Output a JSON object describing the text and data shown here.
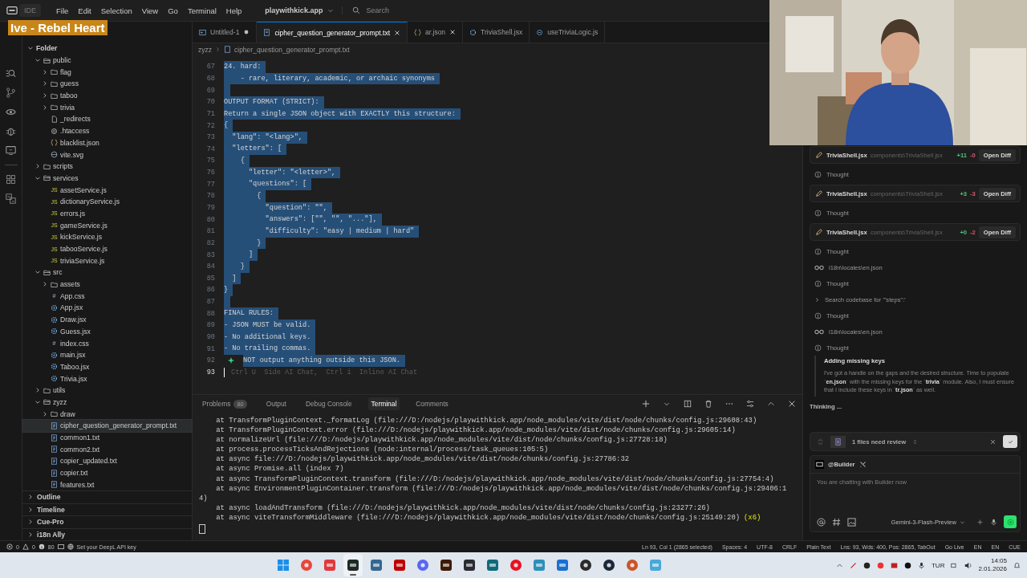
{
  "overlay": {
    "title": "Ive - Rebel Heart"
  },
  "titlebar": {
    "app": "IDE",
    "menus": [
      "File",
      "Edit",
      "Selection",
      "View",
      "Go",
      "Terminal",
      "Help"
    ],
    "workspace": "playwithkick.app",
    "search": {
      "placeholder": "Search"
    }
  },
  "tabs": [
    {
      "label": "Untitled-1",
      "kind": "preview",
      "selected": false,
      "modified": true
    },
    {
      "label": "cipher_question_generator_prompt.txt",
      "kind": "txt",
      "selected": true,
      "modified": false
    },
    {
      "label": "ar.json",
      "kind": "json",
      "selected": false,
      "modified": false
    },
    {
      "label": "TriviaShell.jsx",
      "kind": "react",
      "selected": false,
      "modified": false
    },
    {
      "label": "useTriviaLogic.js",
      "kind": "js",
      "selected": false,
      "modified": false
    }
  ],
  "breadcrumb": [
    "zyzz",
    "cipher_question_generator_prompt.txt"
  ],
  "explorer": {
    "tree": [
      {
        "label": "Folder",
        "kind": "root",
        "expanded": true,
        "selected": false,
        "children": [
          {
            "label": "public",
            "kind": "folder",
            "expanded": true,
            "selected": false,
            "children": [
              {
                "label": "flag",
                "kind": "folder",
                "expanded": false,
                "selected": false
              },
              {
                "label": "guess",
                "kind": "folder",
                "expanded": false,
                "selected": false
              },
              {
                "label": "taboo",
                "kind": "folder",
                "expanded": false,
                "selected": false
              },
              {
                "label": "trivia",
                "kind": "folder",
                "expanded": false,
                "selected": false
              },
              {
                "label": "_redirects",
                "kind": "file",
                "selected": false
              },
              {
                "label": ".htaccess",
                "kind": "gear",
                "selected": false
              },
              {
                "label": "blacklist.json",
                "kind": "json",
                "selected": false
              },
              {
                "label": "vite.svg",
                "kind": "svg",
                "selected": false
              }
            ]
          },
          {
            "label": "scripts",
            "kind": "folder",
            "expanded": false,
            "selected": false
          },
          {
            "label": "services",
            "kind": "folder",
            "expanded": true,
            "selected": false,
            "children": [
              {
                "label": "assetService.js",
                "kind": "js",
                "icon_text": "JS",
                "selected": false
              },
              {
                "label": "dictionaryService.js",
                "kind": "js",
                "icon_text": "JS",
                "selected": false
              },
              {
                "label": "errors.js",
                "kind": "js",
                "icon_text": "JS",
                "selected": false
              },
              {
                "label": "gameService.js",
                "kind": "js",
                "icon_text": "JS",
                "selected": false
              },
              {
                "label": "kickService.js",
                "kind": "js",
                "icon_text": "JS",
                "selected": false
              },
              {
                "label": "tabooService.js",
                "kind": "js",
                "icon_text": "JS",
                "selected": false
              },
              {
                "label": "triviaService.js",
                "kind": "js",
                "icon_text": "JS",
                "selected": false
              }
            ]
          },
          {
            "label": "src",
            "kind": "folder",
            "expanded": true,
            "selected": false,
            "children": [
              {
                "label": "assets",
                "kind": "folder",
                "expanded": false,
                "selected": false
              },
              {
                "label": "App.css",
                "kind": "css",
                "icon_text": "#",
                "selected": false
              },
              {
                "label": "App.jsx",
                "kind": "react",
                "selected": false
              },
              {
                "label": "Draw.jsx",
                "kind": "react",
                "selected": false
              },
              {
                "label": "Guess.jsx",
                "kind": "react",
                "selected": false
              },
              {
                "label": "index.css",
                "kind": "css",
                "icon_text": "#",
                "selected": false
              },
              {
                "label": "main.jsx",
                "kind": "react",
                "selected": false
              },
              {
                "label": "Taboo.jsx",
                "kind": "react",
                "selected": false
              },
              {
                "label": "Trivia.jsx",
                "kind": "react",
                "selected": false
              }
            ]
          },
          {
            "label": "utils",
            "kind": "folder",
            "expanded": false,
            "selected": false
          },
          {
            "label": "zyzz",
            "kind": "folder",
            "expanded": true,
            "selected": false,
            "children": [
              {
                "label": "draw",
                "kind": "folder",
                "expanded": false,
                "selected": false
              },
              {
                "label": "cipher_question_generator_prompt.txt",
                "kind": "txt",
                "selected": true
              },
              {
                "label": "common1.txt",
                "kind": "txt",
                "selected": false
              },
              {
                "label": "common2.txt",
                "kind": "txt",
                "selected": false
              },
              {
                "label": "copier_updated.txt",
                "kind": "txt",
                "selected": false
              },
              {
                "label": "copier.txt",
                "kind": "txt",
                "selected": false
              },
              {
                "label": "features.txt",
                "kind": "txt",
                "selected": false
              }
            ]
          }
        ]
      }
    ],
    "sections": [
      {
        "label": "Outline",
        "expanded": false
      },
      {
        "label": "Timeline",
        "expanded": false
      },
      {
        "label": "Cue-Pro",
        "expanded": false
      },
      {
        "label": "i18n Ally",
        "expanded": false
      }
    ]
  },
  "editor": {
    "lines": [
      {
        "n": "67",
        "kind": "code",
        "text": "24. hard:",
        "selected": true
      },
      {
        "n": "68",
        "kind": "code",
        "text": "    - rare, literary, academic, or archaic synonyms",
        "selected": true
      },
      {
        "n": "69",
        "kind": "code",
        "selected": true
      },
      {
        "n": "70",
        "kind": "code",
        "text": "OUTPUT FORMAT (STRICT):",
        "selected": true
      },
      {
        "n": "71",
        "kind": "code",
        "text": "Return a single JSON object with EXACTLY this structure:",
        "selected": true
      },
      {
        "n": "72",
        "kind": "code",
        "text": "{",
        "selected": true
      },
      {
        "n": "73",
        "kind": "code",
        "text": "  \"lang\": \"<lang>\",",
        "selected": true
      },
      {
        "n": "74",
        "kind": "code",
        "text": "  \"letters\": [",
        "selected": true
      },
      {
        "n": "75",
        "kind": "code",
        "text": "    {",
        "selected": true
      },
      {
        "n": "76",
        "kind": "code",
        "text": "      \"letter\": \"<letter>\",",
        "selected": true
      },
      {
        "n": "77",
        "kind": "code",
        "text": "      \"questions\": [",
        "selected": true
      },
      {
        "n": "78",
        "kind": "code",
        "text": "        {",
        "selected": true
      },
      {
        "n": "79",
        "kind": "code",
        "text": "          \"question\": \"\",",
        "selected": true
      },
      {
        "n": "80",
        "kind": "code",
        "text": "          \"answers\": [\"\", \"\", \"...\"],",
        "selected": true
      },
      {
        "n": "81",
        "kind": "code",
        "text": "          \"difficulty\": \"easy | medium | hard\"",
        "selected": true
      },
      {
        "n": "82",
        "kind": "code",
        "text": "        }",
        "selected": true
      },
      {
        "n": "83",
        "kind": "code",
        "text": "      ]",
        "selected": true
      },
      {
        "n": "84",
        "kind": "code",
        "text": "    }",
        "selected": true
      },
      {
        "n": "85",
        "kind": "code",
        "text": "  ]",
        "selected": true
      },
      {
        "n": "86",
        "kind": "code",
        "text": "}",
        "selected": true
      },
      {
        "n": "87",
        "kind": "code",
        "selected": true
      },
      {
        "n": "88",
        "kind": "code",
        "text": "FINAL RULES:",
        "selected": true
      },
      {
        "n": "89",
        "kind": "code",
        "text": "- JSON MUST be valid.",
        "selected": true
      },
      {
        "n": "90",
        "kind": "code",
        "text": "- No additional keys.",
        "selected": true
      },
      {
        "n": "91",
        "kind": "code",
        "text": "- No trailing commas.",
        "selected": true
      },
      {
        "n": "92",
        "kind": "sparkle",
        "text": "NOT output anything outside this JSON.",
        "selected": true
      },
      {
        "n": "93",
        "kind": "cursor",
        "hint": "Ctrl U  Side AI Chat,  Ctrl i  Inline AI Chat",
        "selected": false
      }
    ]
  },
  "panel": {
    "tabs": [
      {
        "label": "Problems",
        "count": "80",
        "selected": false
      },
      {
        "label": "Output",
        "selected": false
      },
      {
        "label": "Debug Console",
        "selected": false
      },
      {
        "label": "Terminal",
        "selected": true
      },
      {
        "label": "Comments",
        "selected": false
      }
    ],
    "terminal": [
      {
        "text": "    at TransformPluginContext._formatLog (file:///D:/nodejs/playwithkick.app/node_modules/vite/dist/node/chunks/config.js:29608:43)"
      },
      {
        "text": "    at TransformPluginContext.error (file:///D:/nodejs/playwithkick.app/node_modules/vite/dist/node/chunks/config.js:29605:14)"
      },
      {
        "text": "    at normalizeUrl (file:///D:/nodejs/playwithkick.app/node_modules/vite/dist/node/chunks/config.js:27728:18)"
      },
      {
        "text": "    at process.processTicksAndRejections (node:internal/process/task_queues:105:5)"
      },
      {
        "text": "    at async file:///D:/nodejs/playwithkick.app/node_modules/vite/dist/node/chunks/config.js:27786:32"
      },
      {
        "text": "    at async Promise.all (index 7)"
      },
      {
        "text": "    at async TransformPluginContext.transform (file:///D:/nodejs/playwithkick.app/node_modules/vite/dist/node/chunks/config.js:27754:4)"
      },
      {
        "text": "    at async EnvironmentPluginContainer.transform (file:///D:/nodejs/playwithkick.app/node_modules/vite/dist/node/chunks/config.js:29406:1"
      },
      {
        "text": "4)"
      },
      {
        "text": "    at async loadAndTransform (file:///D:/nodejs/playwithkick.app/node_modules/vite/dist/node/chunks/config.js:23277:26)"
      },
      {
        "text": "    at async viteTransformMiddleware (file:///D:/nodejs/playwithkick.app/node_modules/vite/dist/node/chunks/config.js:25149:20)",
        "repeat": "(x6)"
      }
    ]
  },
  "chat": {
    "items": [
      {
        "kind": "edit",
        "file": "TriviaShell.jsx",
        "path": "components\\TriviaShell.jsx",
        "added": "+11",
        "removed": "-0",
        "action": "Open Diff"
      },
      {
        "kind": "thought",
        "label": "Thought"
      },
      {
        "kind": "edit",
        "file": "TriviaShell.jsx",
        "path": "components\\TriviaShell.jsx",
        "added": "+3",
        "removed": "-3",
        "action": "Open Diff"
      },
      {
        "kind": "thought",
        "label": "Thought"
      },
      {
        "kind": "edit",
        "file": "TriviaShell.jsx",
        "path": "components\\TriviaShell.jsx",
        "added": "+0",
        "removed": "-2",
        "action": "Open Diff"
      },
      {
        "kind": "thought",
        "label": "Thought"
      },
      {
        "kind": "read",
        "label": "i18n\\locales\\en.json"
      },
      {
        "kind": "thought",
        "label": "Thought"
      },
      {
        "kind": "search",
        "label": "Search codebase for '\"steps\":'"
      },
      {
        "kind": "thought",
        "label": "Thought"
      },
      {
        "kind": "read",
        "label": "i18n\\locales\\en.json"
      },
      {
        "kind": "thought",
        "label": "Thought",
        "title": "Adding missing keys",
        "body": "I've got a handle on the gaps and the desired structure. Time to populate `**en.json**` with the missing keys for the `**trivia**` module. Also, I must ensure that I include these keys in `**tr.json**` as well."
      }
    ],
    "status": "Thinking ...",
    "review": "1 files need review",
    "agent": "@Builder",
    "input": {
      "placeholder": "You are chatting with Builder now"
    },
    "model": "Gemini-3-Flash-Preview"
  },
  "statusbar": {
    "errors": "0",
    "warnings": "0",
    "infos": "80",
    "deepl": "Set your DeepL API key",
    "right": [
      "Ln 93, Col 1 (2865 selected)",
      "Spaces: 4",
      "UTF-8",
      "CRLF",
      "Plain Text",
      "Lns: 93, Wds: 400, Pos: 2865, TabOut",
      "Go Live",
      "EN",
      "EN",
      "CUE"
    ]
  },
  "taskbar": {
    "apps": [
      {
        "kind": "windows",
        "color": "#1a8ee8",
        "active": false
      },
      {
        "kind": "circle",
        "color": "#e8453c",
        "active": false
      },
      {
        "kind": "square",
        "color": "#e03a3e",
        "active": false
      },
      {
        "kind": "square",
        "color": "#1d2a24",
        "active": true
      },
      {
        "kind": "square",
        "color": "#336791",
        "active": false
      },
      {
        "kind": "square",
        "color": "#bf0000",
        "active": false
      },
      {
        "kind": "circle",
        "color": "#5865f2",
        "active": false
      },
      {
        "kind": "square",
        "color": "#3d1a00",
        "active": false
      },
      {
        "kind": "square",
        "color": "#2b2b33",
        "active": false
      },
      {
        "kind": "square",
        "color": "#0f6a7a",
        "active": false
      },
      {
        "kind": "circle",
        "color": "#e81123",
        "active": false
      },
      {
        "kind": "square",
        "color": "#2e8fb8",
        "active": false
      },
      {
        "kind": "square",
        "color": "#1a6fd1",
        "active": false
      },
      {
        "kind": "circle",
        "color": "#2a2a2a",
        "active": false
      },
      {
        "kind": "circle",
        "color": "#1b2838",
        "active": false
      },
      {
        "kind": "circle",
        "color": "#c9542a",
        "active": false
      },
      {
        "kind": "square",
        "color": "#4aa8d8",
        "active": false
      }
    ],
    "language": "TUR",
    "time": "14:05",
    "date": "2.01.2026"
  }
}
